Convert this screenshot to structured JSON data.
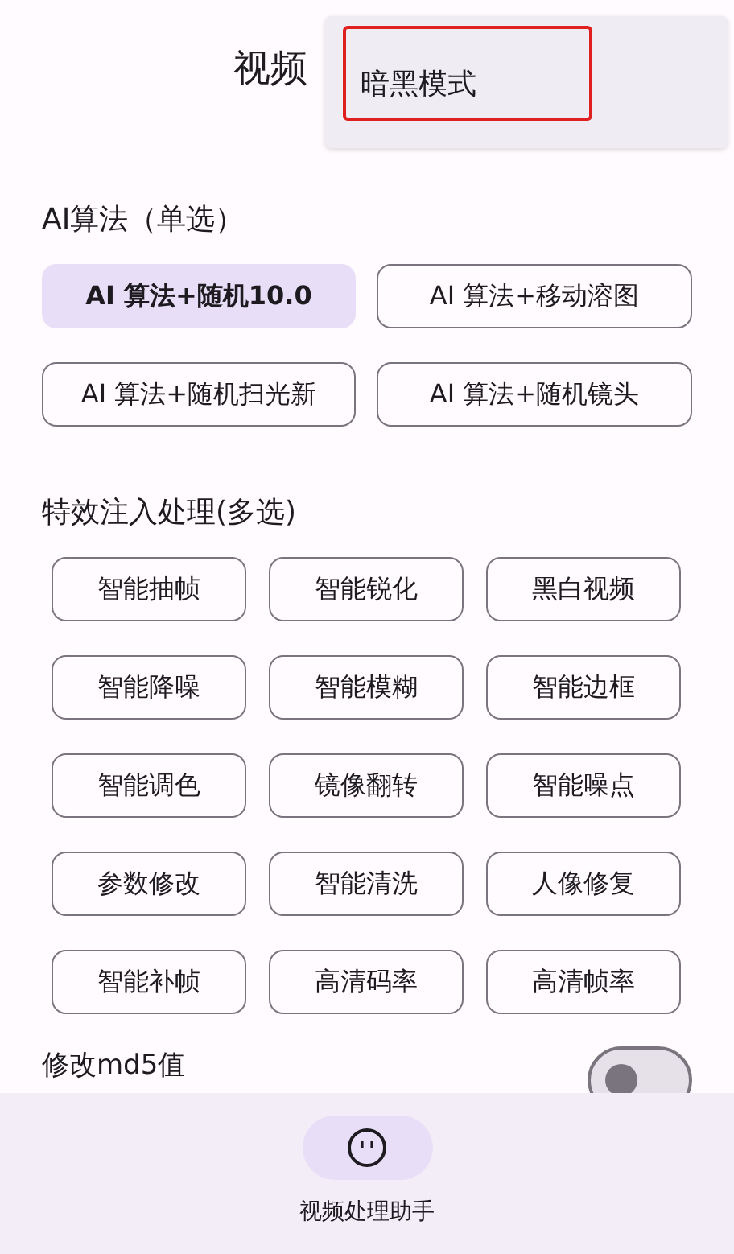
{
  "title": "视频",
  "menu": {
    "items": [
      {
        "label": "暗黑模式",
        "highlighted": true
      }
    ]
  },
  "algorithm": {
    "heading": "AI算法（单选）",
    "options": [
      {
        "label": "AI 算法+随机10.0",
        "selected": true
      },
      {
        "label": "AI 算法+移动溶图",
        "selected": false
      },
      {
        "label": "AI 算法+随机扫光新",
        "selected": false
      },
      {
        "label": "AI 算法+随机镜头",
        "selected": false
      }
    ]
  },
  "effects": {
    "heading": "特效注入处理(多选)",
    "options": [
      {
        "label": "智能抽帧",
        "selected": false
      },
      {
        "label": "智能锐化",
        "selected": false
      },
      {
        "label": "黑白视频",
        "selected": false
      },
      {
        "label": "智能降噪",
        "selected": false
      },
      {
        "label": "智能模糊",
        "selected": false
      },
      {
        "label": "智能边框",
        "selected": false
      },
      {
        "label": "智能调色",
        "selected": false
      },
      {
        "label": "镜像翻转",
        "selected": false
      },
      {
        "label": "智能噪点",
        "selected": false
      },
      {
        "label": "参数修改",
        "selected": false
      },
      {
        "label": "智能清洗",
        "selected": false
      },
      {
        "label": "人像修复",
        "selected": false
      },
      {
        "label": "智能补帧",
        "selected": false
      },
      {
        "label": "高清码率",
        "selected": false
      },
      {
        "label": "高清帧率",
        "selected": false
      }
    ]
  },
  "md5_switch": {
    "label": "修改md5值",
    "on": false
  },
  "bottom_nav": {
    "items": [
      {
        "label": "视频处理助手",
        "selected": true
      }
    ]
  }
}
